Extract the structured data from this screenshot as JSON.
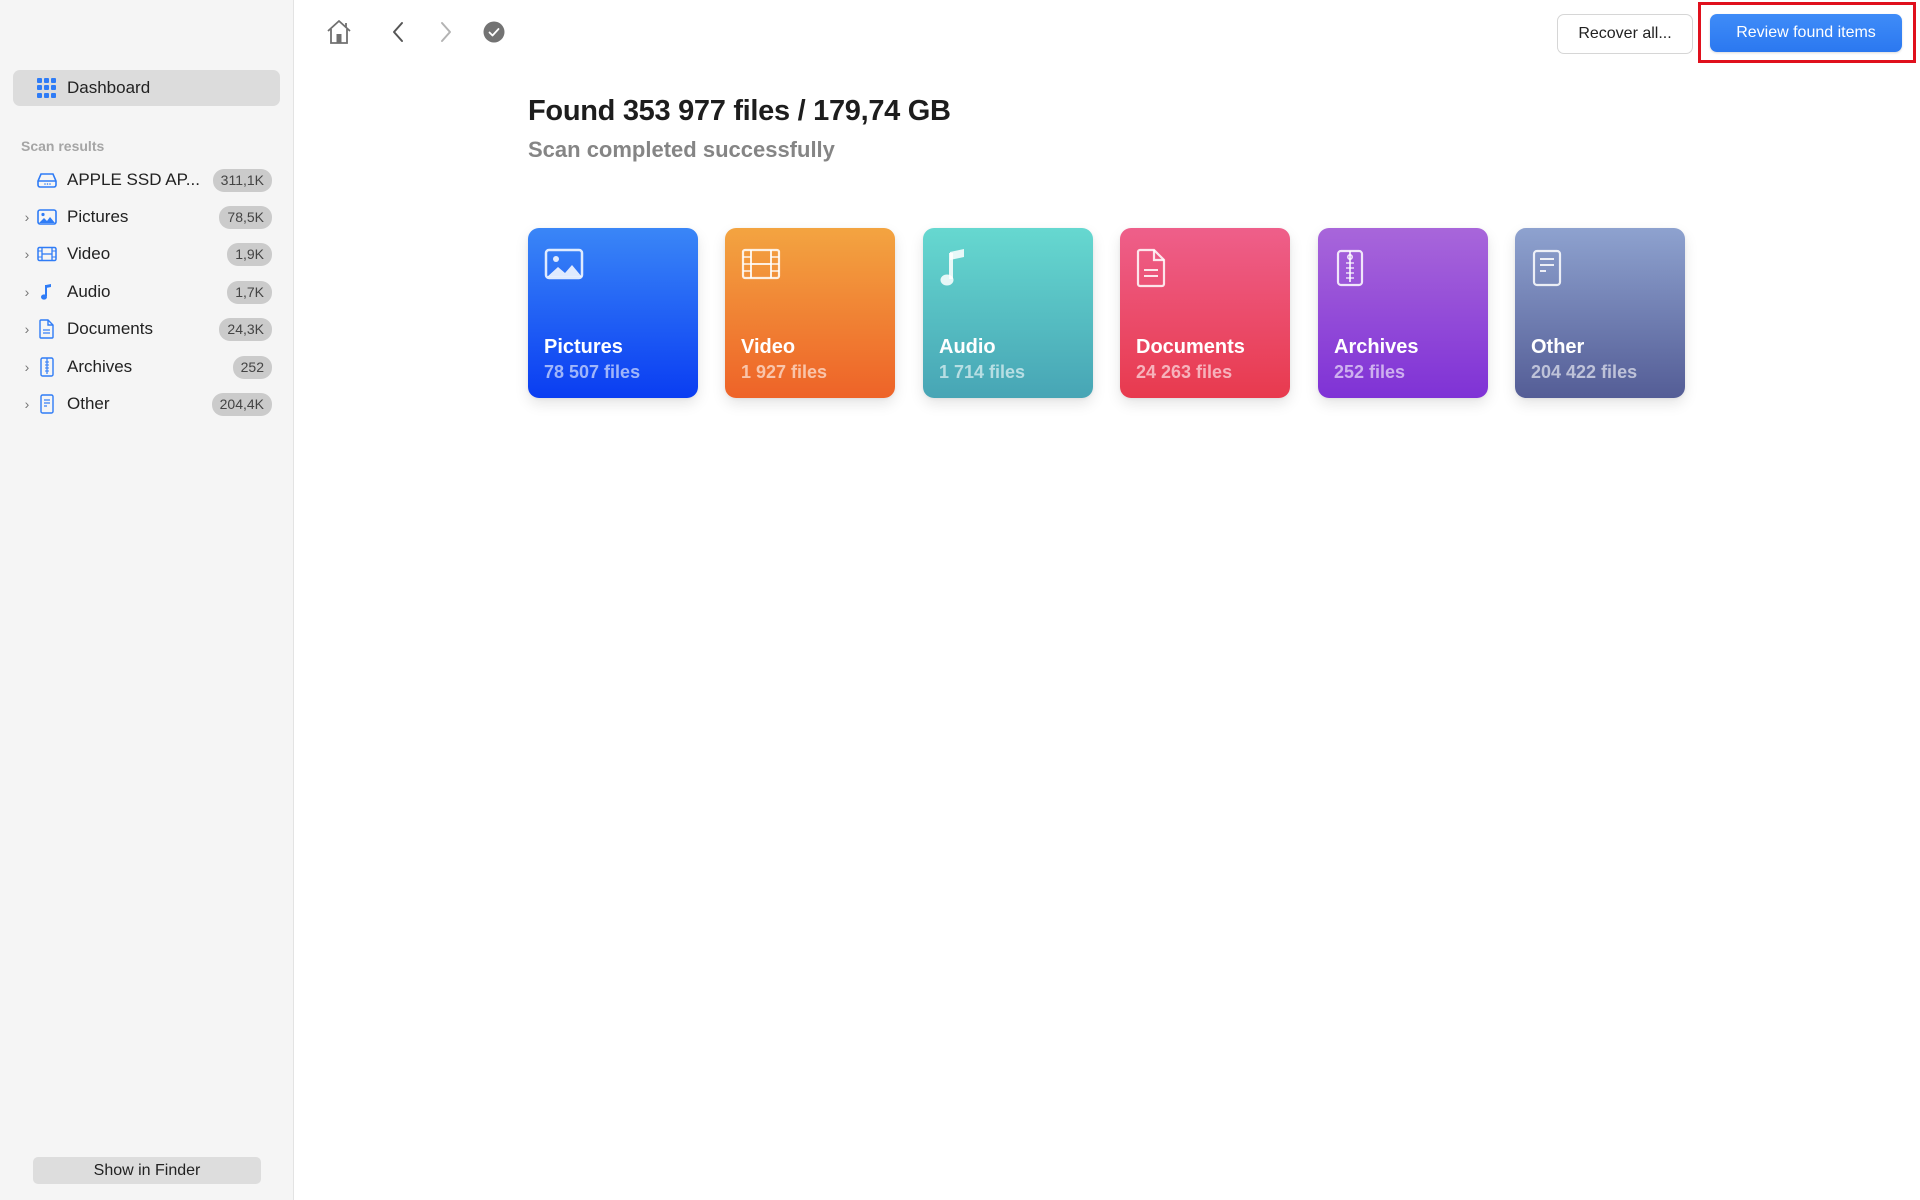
{
  "sidebar": {
    "dashboard_label": "Dashboard",
    "section_label": "Scan results",
    "items": [
      {
        "label": "APPLE SSD AP...",
        "badge": "311,1K",
        "icon": "drive-icon",
        "expandable": false
      },
      {
        "label": "Pictures",
        "badge": "78,5K",
        "icon": "picture-icon",
        "expandable": true
      },
      {
        "label": "Video",
        "badge": "1,9K",
        "icon": "film-icon",
        "expandable": true
      },
      {
        "label": "Audio",
        "badge": "1,7K",
        "icon": "music-note-icon",
        "expandable": true
      },
      {
        "label": "Documents",
        "badge": "24,3K",
        "icon": "document-icon",
        "expandable": true
      },
      {
        "label": "Archives",
        "badge": "252",
        "icon": "archive-icon",
        "expandable": true
      },
      {
        "label": "Other",
        "badge": "204,4K",
        "icon": "other-file-icon",
        "expandable": true
      }
    ],
    "show_in_finder_label": "Show in Finder",
    "accent_color": "#2f7cf6"
  },
  "toolbar": {
    "recover_all_label": "Recover all...",
    "review_label": "Review found items"
  },
  "main": {
    "title": "Found 353 977 files / 179,74 GB",
    "subtitle": "Scan completed successfully",
    "cards": [
      {
        "name": "Pictures",
        "count": "78 507 files",
        "icon": "picture-icon",
        "colors": [
          "#3a86f7",
          "#0a3df2"
        ]
      },
      {
        "name": "Video",
        "count": "1 927 files",
        "icon": "film-icon",
        "colors": [
          "#f3a441",
          "#ee6328"
        ]
      },
      {
        "name": "Audio",
        "count": "1 714 files",
        "icon": "music-note-icon",
        "colors": [
          "#66d8d0",
          "#47a5b5"
        ]
      },
      {
        "name": "Documents",
        "count": "24 263 files",
        "icon": "document-icon",
        "colors": [
          "#ee5f8a",
          "#e83a4e"
        ]
      },
      {
        "name": "Archives",
        "count": "252 files",
        "icon": "archive-icon",
        "colors": [
          "#a866da",
          "#7f32d6"
        ]
      },
      {
        "name": "Other",
        "count": "204 422 files",
        "icon": "other-file-icon",
        "colors": [
          "#8ea2cf",
          "#545d96"
        ]
      }
    ]
  }
}
